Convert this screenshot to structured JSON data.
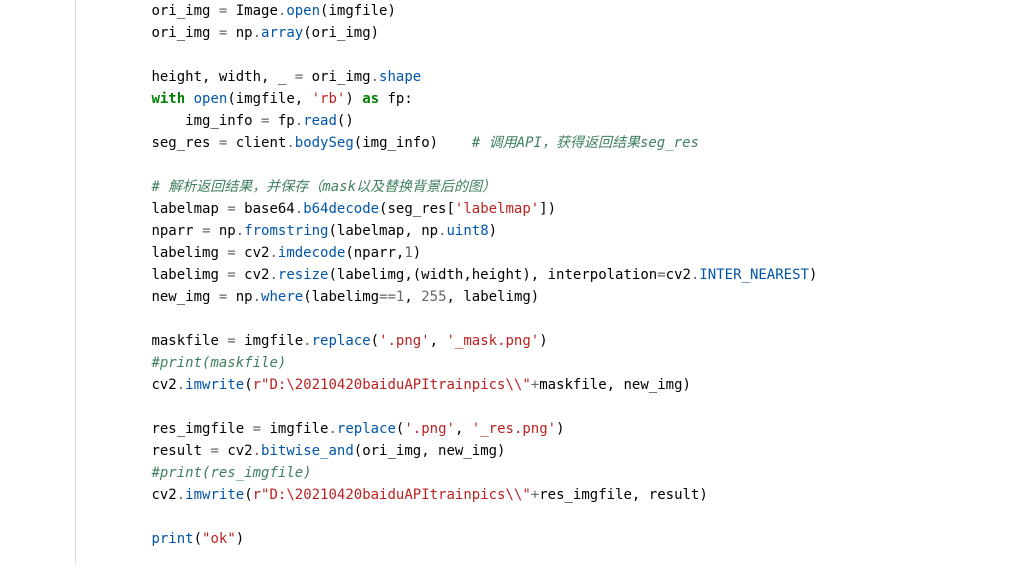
{
  "code": {
    "lines": [
      {
        "indent": 2,
        "tokens": [
          {
            "t": "ori_img ",
            "cls": "n"
          },
          {
            "t": "=",
            "cls": "op"
          },
          {
            "t": " Image",
            "cls": "n"
          },
          {
            "t": ".",
            "cls": "op"
          },
          {
            "t": "open",
            "cls": "fn"
          },
          {
            "t": "(imgfile)",
            "cls": "n"
          }
        ]
      },
      {
        "indent": 2,
        "tokens": [
          {
            "t": "ori_img ",
            "cls": "n"
          },
          {
            "t": "=",
            "cls": "op"
          },
          {
            "t": " np",
            "cls": "n"
          },
          {
            "t": ".",
            "cls": "op"
          },
          {
            "t": "array",
            "cls": "fn"
          },
          {
            "t": "(ori_img)",
            "cls": "n"
          }
        ]
      },
      {
        "blank": true
      },
      {
        "indent": 2,
        "tokens": [
          {
            "t": "height, width, _ ",
            "cls": "n"
          },
          {
            "t": "=",
            "cls": "op"
          },
          {
            "t": " ori_img",
            "cls": "n"
          },
          {
            "t": ".",
            "cls": "op"
          },
          {
            "t": "shape",
            "cls": "fn"
          }
        ]
      },
      {
        "indent": 2,
        "tokens": [
          {
            "t": "with",
            "cls": "k"
          },
          {
            "t": " ",
            "cls": "n"
          },
          {
            "t": "open",
            "cls": "fn"
          },
          {
            "t": "(imgfile, ",
            "cls": "n"
          },
          {
            "t": "'rb'",
            "cls": "s"
          },
          {
            "t": ") ",
            "cls": "n"
          },
          {
            "t": "as",
            "cls": "k"
          },
          {
            "t": " fp:",
            "cls": "n"
          }
        ]
      },
      {
        "indent": 3,
        "tokens": [
          {
            "t": "img_info ",
            "cls": "n"
          },
          {
            "t": "=",
            "cls": "op"
          },
          {
            "t": " fp",
            "cls": "n"
          },
          {
            "t": ".",
            "cls": "op"
          },
          {
            "t": "read",
            "cls": "fn"
          },
          {
            "t": "()",
            "cls": "n"
          }
        ]
      },
      {
        "indent": 2,
        "tokens": [
          {
            "t": "seg_res ",
            "cls": "n"
          },
          {
            "t": "=",
            "cls": "op"
          },
          {
            "t": " client",
            "cls": "n"
          },
          {
            "t": ".",
            "cls": "op"
          },
          {
            "t": "bodySeg",
            "cls": "fn"
          },
          {
            "t": "(img_info)    ",
            "cls": "n"
          },
          {
            "t": "# 调用API，获得返回结果seg_res",
            "cls": "c"
          }
        ]
      },
      {
        "blank": true
      },
      {
        "indent": 2,
        "tokens": [
          {
            "t": "# 解析返回结果，并保存（mask以及替换背景后的图）",
            "cls": "c"
          }
        ]
      },
      {
        "indent": 2,
        "tokens": [
          {
            "t": "labelmap ",
            "cls": "n"
          },
          {
            "t": "=",
            "cls": "op"
          },
          {
            "t": " base64",
            "cls": "n"
          },
          {
            "t": ".",
            "cls": "op"
          },
          {
            "t": "b64decode",
            "cls": "fn"
          },
          {
            "t": "(seg_res[",
            "cls": "n"
          },
          {
            "t": "'labelmap'",
            "cls": "s"
          },
          {
            "t": "])",
            "cls": "n"
          }
        ]
      },
      {
        "indent": 2,
        "tokens": [
          {
            "t": "nparr ",
            "cls": "n"
          },
          {
            "t": "=",
            "cls": "op"
          },
          {
            "t": " np",
            "cls": "n"
          },
          {
            "t": ".",
            "cls": "op"
          },
          {
            "t": "fromstring",
            "cls": "fn"
          },
          {
            "t": "(labelmap, np",
            "cls": "n"
          },
          {
            "t": ".",
            "cls": "op"
          },
          {
            "t": "uint8",
            "cls": "fn"
          },
          {
            "t": ")",
            "cls": "n"
          }
        ]
      },
      {
        "indent": 2,
        "tokens": [
          {
            "t": "labelimg ",
            "cls": "n"
          },
          {
            "t": "=",
            "cls": "op"
          },
          {
            "t": " cv2",
            "cls": "n"
          },
          {
            "t": ".",
            "cls": "op"
          },
          {
            "t": "imdecode",
            "cls": "fn"
          },
          {
            "t": "(nparr,",
            "cls": "n"
          },
          {
            "t": "1",
            "cls": "num"
          },
          {
            "t": ")",
            "cls": "n"
          }
        ]
      },
      {
        "indent": 2,
        "tokens": [
          {
            "t": "labelimg ",
            "cls": "n"
          },
          {
            "t": "=",
            "cls": "op"
          },
          {
            "t": " cv2",
            "cls": "n"
          },
          {
            "t": ".",
            "cls": "op"
          },
          {
            "t": "resize",
            "cls": "fn"
          },
          {
            "t": "(labelimg,(width,height), interpolation",
            "cls": "n"
          },
          {
            "t": "=",
            "cls": "op"
          },
          {
            "t": "cv2",
            "cls": "n"
          },
          {
            "t": ".",
            "cls": "op"
          },
          {
            "t": "INTER_NEAREST",
            "cls": "fn"
          },
          {
            "t": ")",
            "cls": "n"
          }
        ]
      },
      {
        "indent": 2,
        "tokens": [
          {
            "t": "new_img ",
            "cls": "n"
          },
          {
            "t": "=",
            "cls": "op"
          },
          {
            "t": " np",
            "cls": "n"
          },
          {
            "t": ".",
            "cls": "op"
          },
          {
            "t": "where",
            "cls": "fn"
          },
          {
            "t": "(labelimg",
            "cls": "n"
          },
          {
            "t": "==",
            "cls": "op"
          },
          {
            "t": "1",
            "cls": "num"
          },
          {
            "t": ", ",
            "cls": "n"
          },
          {
            "t": "255",
            "cls": "num"
          },
          {
            "t": ", labelimg)",
            "cls": "n"
          }
        ]
      },
      {
        "blank": true
      },
      {
        "indent": 2,
        "tokens": [
          {
            "t": "maskfile ",
            "cls": "n"
          },
          {
            "t": "=",
            "cls": "op"
          },
          {
            "t": " imgfile",
            "cls": "n"
          },
          {
            "t": ".",
            "cls": "op"
          },
          {
            "t": "replace",
            "cls": "fn"
          },
          {
            "t": "(",
            "cls": "n"
          },
          {
            "t": "'.png'",
            "cls": "s"
          },
          {
            "t": ", ",
            "cls": "n"
          },
          {
            "t": "'_mask.png'",
            "cls": "s"
          },
          {
            "t": ")",
            "cls": "n"
          }
        ]
      },
      {
        "indent": 2,
        "tokens": [
          {
            "t": "#print(maskfile)",
            "cls": "c"
          }
        ]
      },
      {
        "indent": 2,
        "tokens": [
          {
            "t": "cv2",
            "cls": "n"
          },
          {
            "t": ".",
            "cls": "op"
          },
          {
            "t": "imwrite",
            "cls": "fn"
          },
          {
            "t": "(",
            "cls": "n"
          },
          {
            "t": "r\"D:\\20210420baiduAPItrainpics\\\\\"",
            "cls": "s"
          },
          {
            "t": "+",
            "cls": "op"
          },
          {
            "t": "maskfile, new_img)",
            "cls": "n"
          }
        ]
      },
      {
        "blank": true
      },
      {
        "indent": 2,
        "tokens": [
          {
            "t": "res_imgfile ",
            "cls": "n"
          },
          {
            "t": "=",
            "cls": "op"
          },
          {
            "t": " imgfile",
            "cls": "n"
          },
          {
            "t": ".",
            "cls": "op"
          },
          {
            "t": "replace",
            "cls": "fn"
          },
          {
            "t": "(",
            "cls": "n"
          },
          {
            "t": "'.png'",
            "cls": "s"
          },
          {
            "t": ", ",
            "cls": "n"
          },
          {
            "t": "'_res.png'",
            "cls": "s"
          },
          {
            "t": ")",
            "cls": "n"
          }
        ]
      },
      {
        "indent": 2,
        "tokens": [
          {
            "t": "result ",
            "cls": "n"
          },
          {
            "t": "=",
            "cls": "op"
          },
          {
            "t": " cv2",
            "cls": "n"
          },
          {
            "t": ".",
            "cls": "op"
          },
          {
            "t": "bitwise_and",
            "cls": "fn"
          },
          {
            "t": "(ori_img, new_img)",
            "cls": "n"
          }
        ]
      },
      {
        "indent": 2,
        "tokens": [
          {
            "t": "#print(res_imgfile)",
            "cls": "c"
          }
        ]
      },
      {
        "indent": 2,
        "tokens": [
          {
            "t": "cv2",
            "cls": "n"
          },
          {
            "t": ".",
            "cls": "op"
          },
          {
            "t": "imwrite",
            "cls": "fn"
          },
          {
            "t": "(",
            "cls": "n"
          },
          {
            "t": "r\"D:\\20210420baiduAPItrainpics\\\\\"",
            "cls": "s"
          },
          {
            "t": "+",
            "cls": "op"
          },
          {
            "t": "res_imgfile, result)",
            "cls": "n"
          }
        ]
      },
      {
        "blank": true
      },
      {
        "indent": 2,
        "tokens": [
          {
            "t": "print",
            "cls": "fn"
          },
          {
            "t": "(",
            "cls": "n"
          },
          {
            "t": "\"ok\"",
            "cls": "s"
          },
          {
            "t": ")",
            "cls": "n"
          }
        ]
      }
    ]
  }
}
